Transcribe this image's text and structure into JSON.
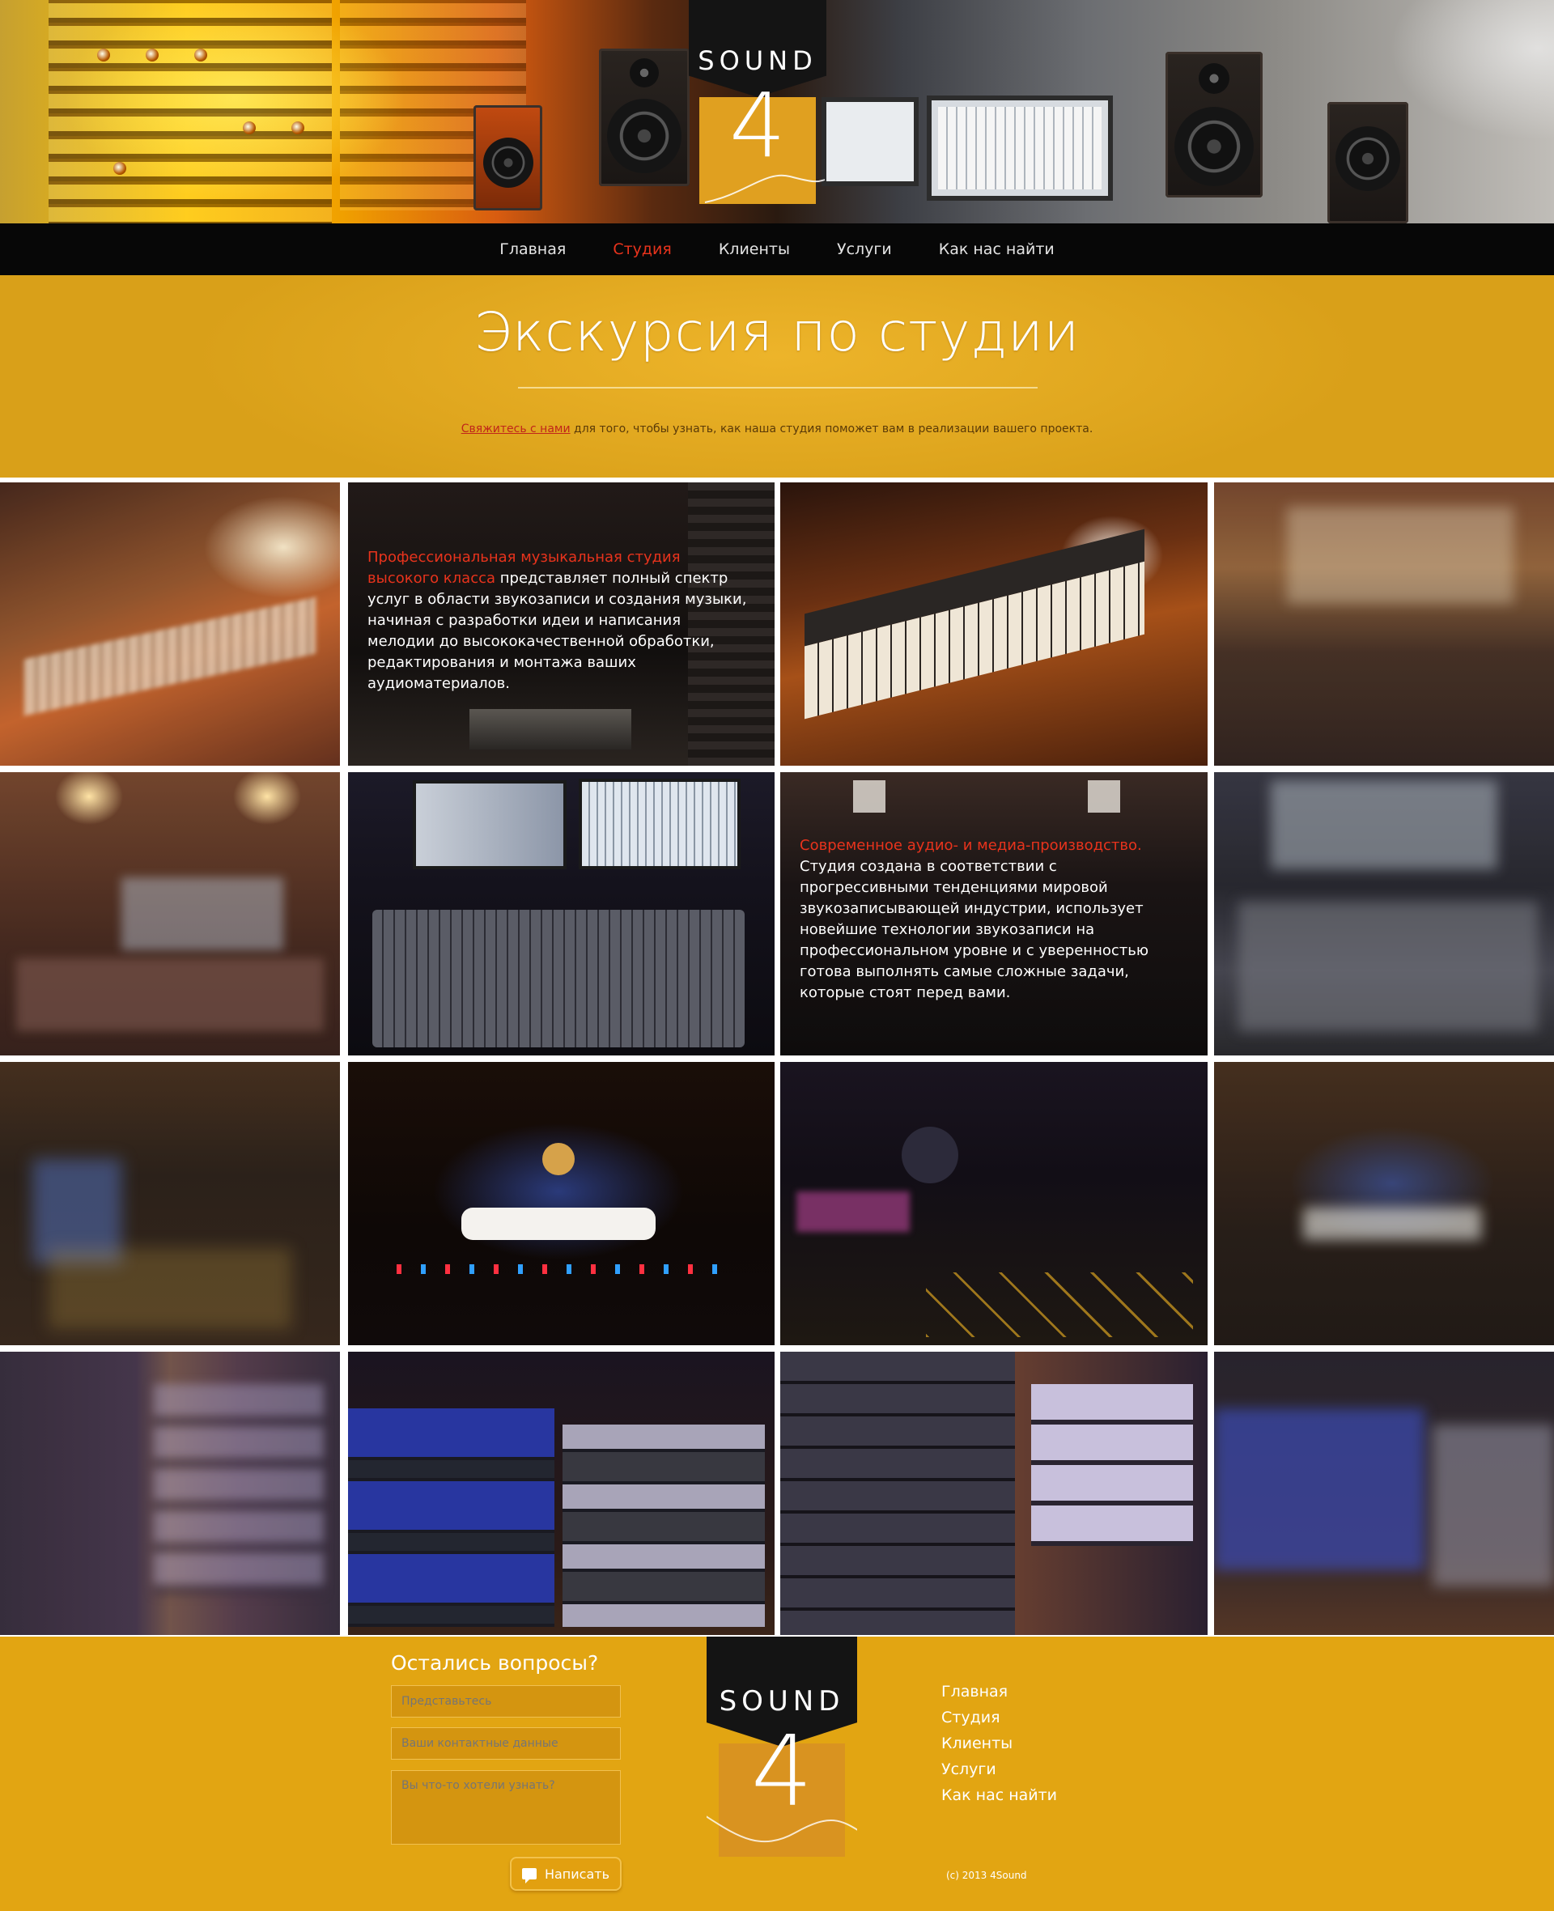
{
  "logo": {
    "word": "SOUND",
    "number": "4"
  },
  "nav": {
    "items": [
      {
        "label": "Главная",
        "active": false
      },
      {
        "label": "Студия",
        "active": true
      },
      {
        "label": "Клиенты",
        "active": false
      },
      {
        "label": "Услуги",
        "active": false
      },
      {
        "label": "Как нас найти",
        "active": false
      }
    ]
  },
  "intro": {
    "title": "Экскурсия по студии",
    "link_text": "Свяжитесь с нами",
    "text": " для того, чтобы узнать, как наша студия поможет вам в реализации вашего проекта."
  },
  "gallery": {
    "caption_1": {
      "accent": "Профессиональная музыкальная студия высокого класса",
      "text": " представляет полный спектр услуг в области звукозаписи и создания музыки, начиная с разработки идеи и написания мелодии до высококачественной обработки, редактирования и монтажа ваших аудиоматериалов."
    },
    "caption_2": {
      "accent": "Современное аудио- и медиа-производство.",
      "text": " Студия создана в соответствии с прогрессивными тенденциями мировой звукозаписывающей индустрии, использует новейшие технологии звукозаписи на профессиональном уровне и с уверенностью готова выполнять самые сложные задачи, которые стоят перед вами."
    }
  },
  "footer": {
    "form_title": "Остались вопросы?",
    "name_placeholder": "Представьтесь",
    "contact_placeholder": "Ваши контактные данные",
    "question_placeholder": "Вы что-то хотели узнать?",
    "send_label": "Написать",
    "links": [
      "Главная",
      "Студия",
      "Клиенты",
      "Услуги",
      "Как нас найти"
    ],
    "copyright": "(c) 2013 4Sound"
  },
  "colors": {
    "accent": "#e8331c",
    "brand_yellow": "#e2a512",
    "nav_bg": "#070707"
  }
}
